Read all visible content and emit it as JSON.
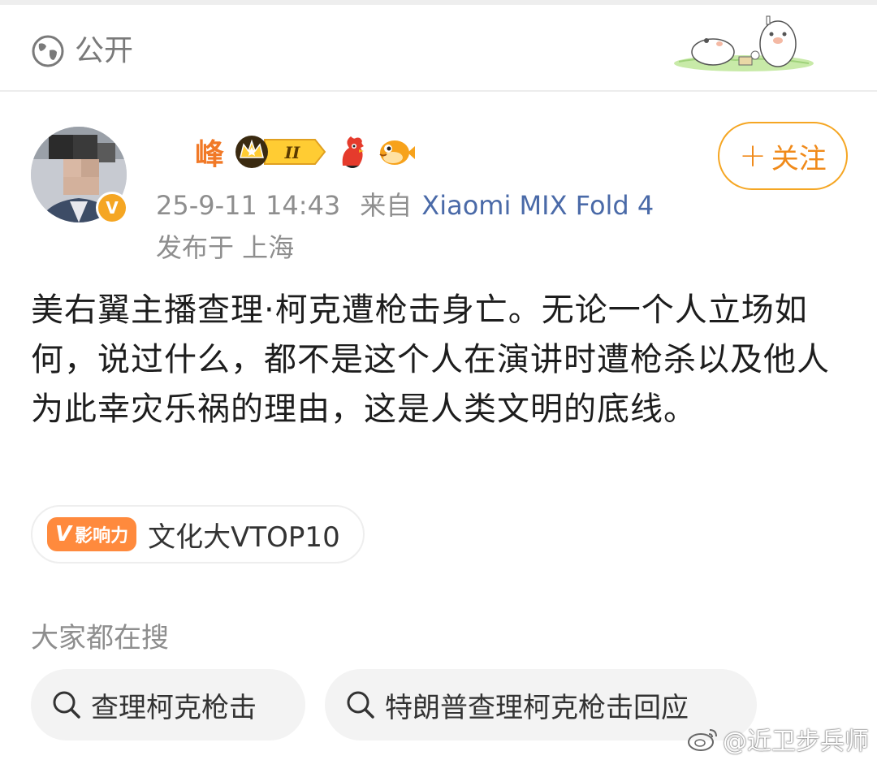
{
  "header": {
    "visibility_icon": "globe-icon",
    "visibility_label": "公开",
    "decoration": "cartoon-pig-illustration"
  },
  "post": {
    "author": {
      "name_visible": "峰",
      "avatar": "blurred-avatar",
      "verified_badge": "V",
      "badges": [
        "crown-level-badge-II",
        "rooster-icon",
        "pufferfish-icon"
      ]
    },
    "timestamp": "25-9-11 14:43",
    "source_prefix": "来自",
    "source_device": "Xiaomi MIX Fold 4",
    "location": "发布于 上海",
    "follow_button": {
      "plus": "+",
      "label": "关注"
    },
    "text": "美右翼主播查理·柯克遭枪击身亡。无论一个人立场如何，说过什么，都不是这个人在演讲时遭枪杀以及他人为此幸灾乐祸的理由，这是人类文明的底线。",
    "influence": {
      "badge_v": "V",
      "badge_label": "影响力",
      "text": "文化大VTOP10"
    }
  },
  "search": {
    "heading": "大家都在搜",
    "chips": [
      {
        "icon": "search-icon",
        "label": "查理柯克枪击"
      },
      {
        "icon": "search-icon",
        "label": "特朗普查理柯克枪击回应"
      }
    ]
  },
  "watermark": {
    "icon": "weibo-icon",
    "text": "@近卫步兵师"
  },
  "colors": {
    "accent_orange": "#f5a623",
    "username_orange": "#f06b10",
    "link_blue": "#4a6aa8",
    "meta_gray": "#8e8e8e"
  }
}
